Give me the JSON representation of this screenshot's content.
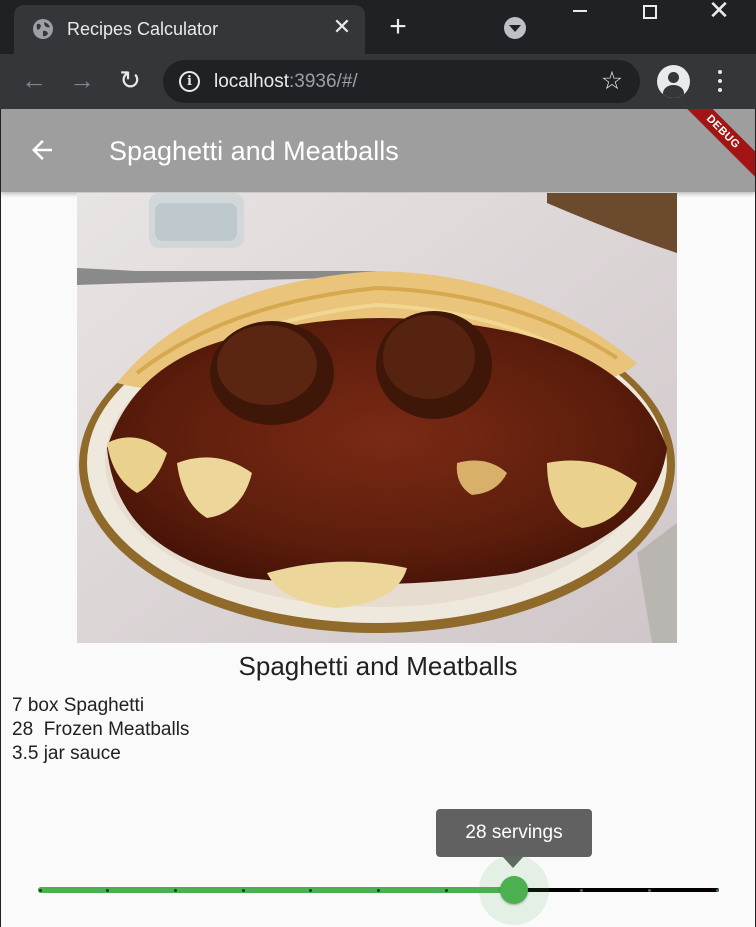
{
  "browser": {
    "tab_title": "Recipes Calculator",
    "url_host": "localhost",
    "url_rest": ":3936/#/"
  },
  "app": {
    "appbar_title": "Spaghetti and Meatballs",
    "debug_label": "DEBUG",
    "recipe_title": "Spaghetti and Meatballs",
    "ingredients": [
      {
        "text": "7 box Spaghetti"
      },
      {
        "text": "28  Frozen Meatballs"
      },
      {
        "text": "3.5 jar sauce"
      }
    ],
    "slider": {
      "label": "28 servings",
      "value": 28,
      "min": 0,
      "max": 40,
      "divisions": 10,
      "active_color": "#4caf50",
      "inactive_color": "#000000"
    }
  },
  "icons": {
    "back": "arrow-back-icon",
    "favicon": "globe-icon",
    "star": "star-icon",
    "menu": "more-vert-icon"
  }
}
